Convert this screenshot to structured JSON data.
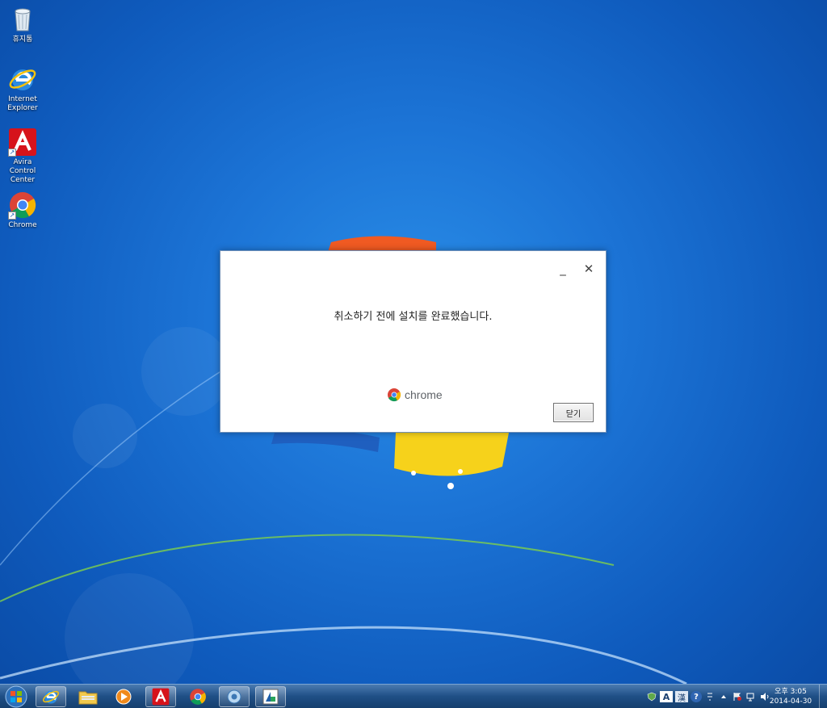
{
  "desktop": {
    "icons": [
      {
        "label": "휴지통",
        "icon": "recycle-bin-icon"
      },
      {
        "label": "Internet Explorer",
        "icon": "internet-explorer-icon"
      },
      {
        "label": "Avira Control Center",
        "icon": "avira-icon"
      },
      {
        "label": "Chrome",
        "icon": "chrome-icon"
      }
    ]
  },
  "dialog": {
    "message": "취소하기 전에 설치를 완료했습니다.",
    "brand": "chrome",
    "close_button_label": "닫기",
    "minimize_glyph": "_",
    "close_glyph": "✕"
  },
  "taskbar": {
    "items": [
      {
        "name": "internet-explorer",
        "icon": "internet-explorer-icon"
      },
      {
        "name": "file-explorer",
        "icon": "folder-icon"
      },
      {
        "name": "media-player",
        "icon": "media-player-icon"
      },
      {
        "name": "avira",
        "icon": "avira-icon"
      },
      {
        "name": "chrome",
        "icon": "chrome-icon"
      },
      {
        "name": "control-panel",
        "icon": "settings-icon"
      },
      {
        "name": "installer",
        "icon": "installer-icon"
      }
    ],
    "tray": {
      "ime_label": "A",
      "ime_hanja": "漢",
      "help_glyph": "?"
    },
    "clock": {
      "time": "오후 3:05",
      "date": "2014-04-30"
    }
  },
  "colors": {
    "desktop_blue": "#1c74d6",
    "taskbar": "#1f4f86",
    "avira_red": "#d6131b"
  }
}
